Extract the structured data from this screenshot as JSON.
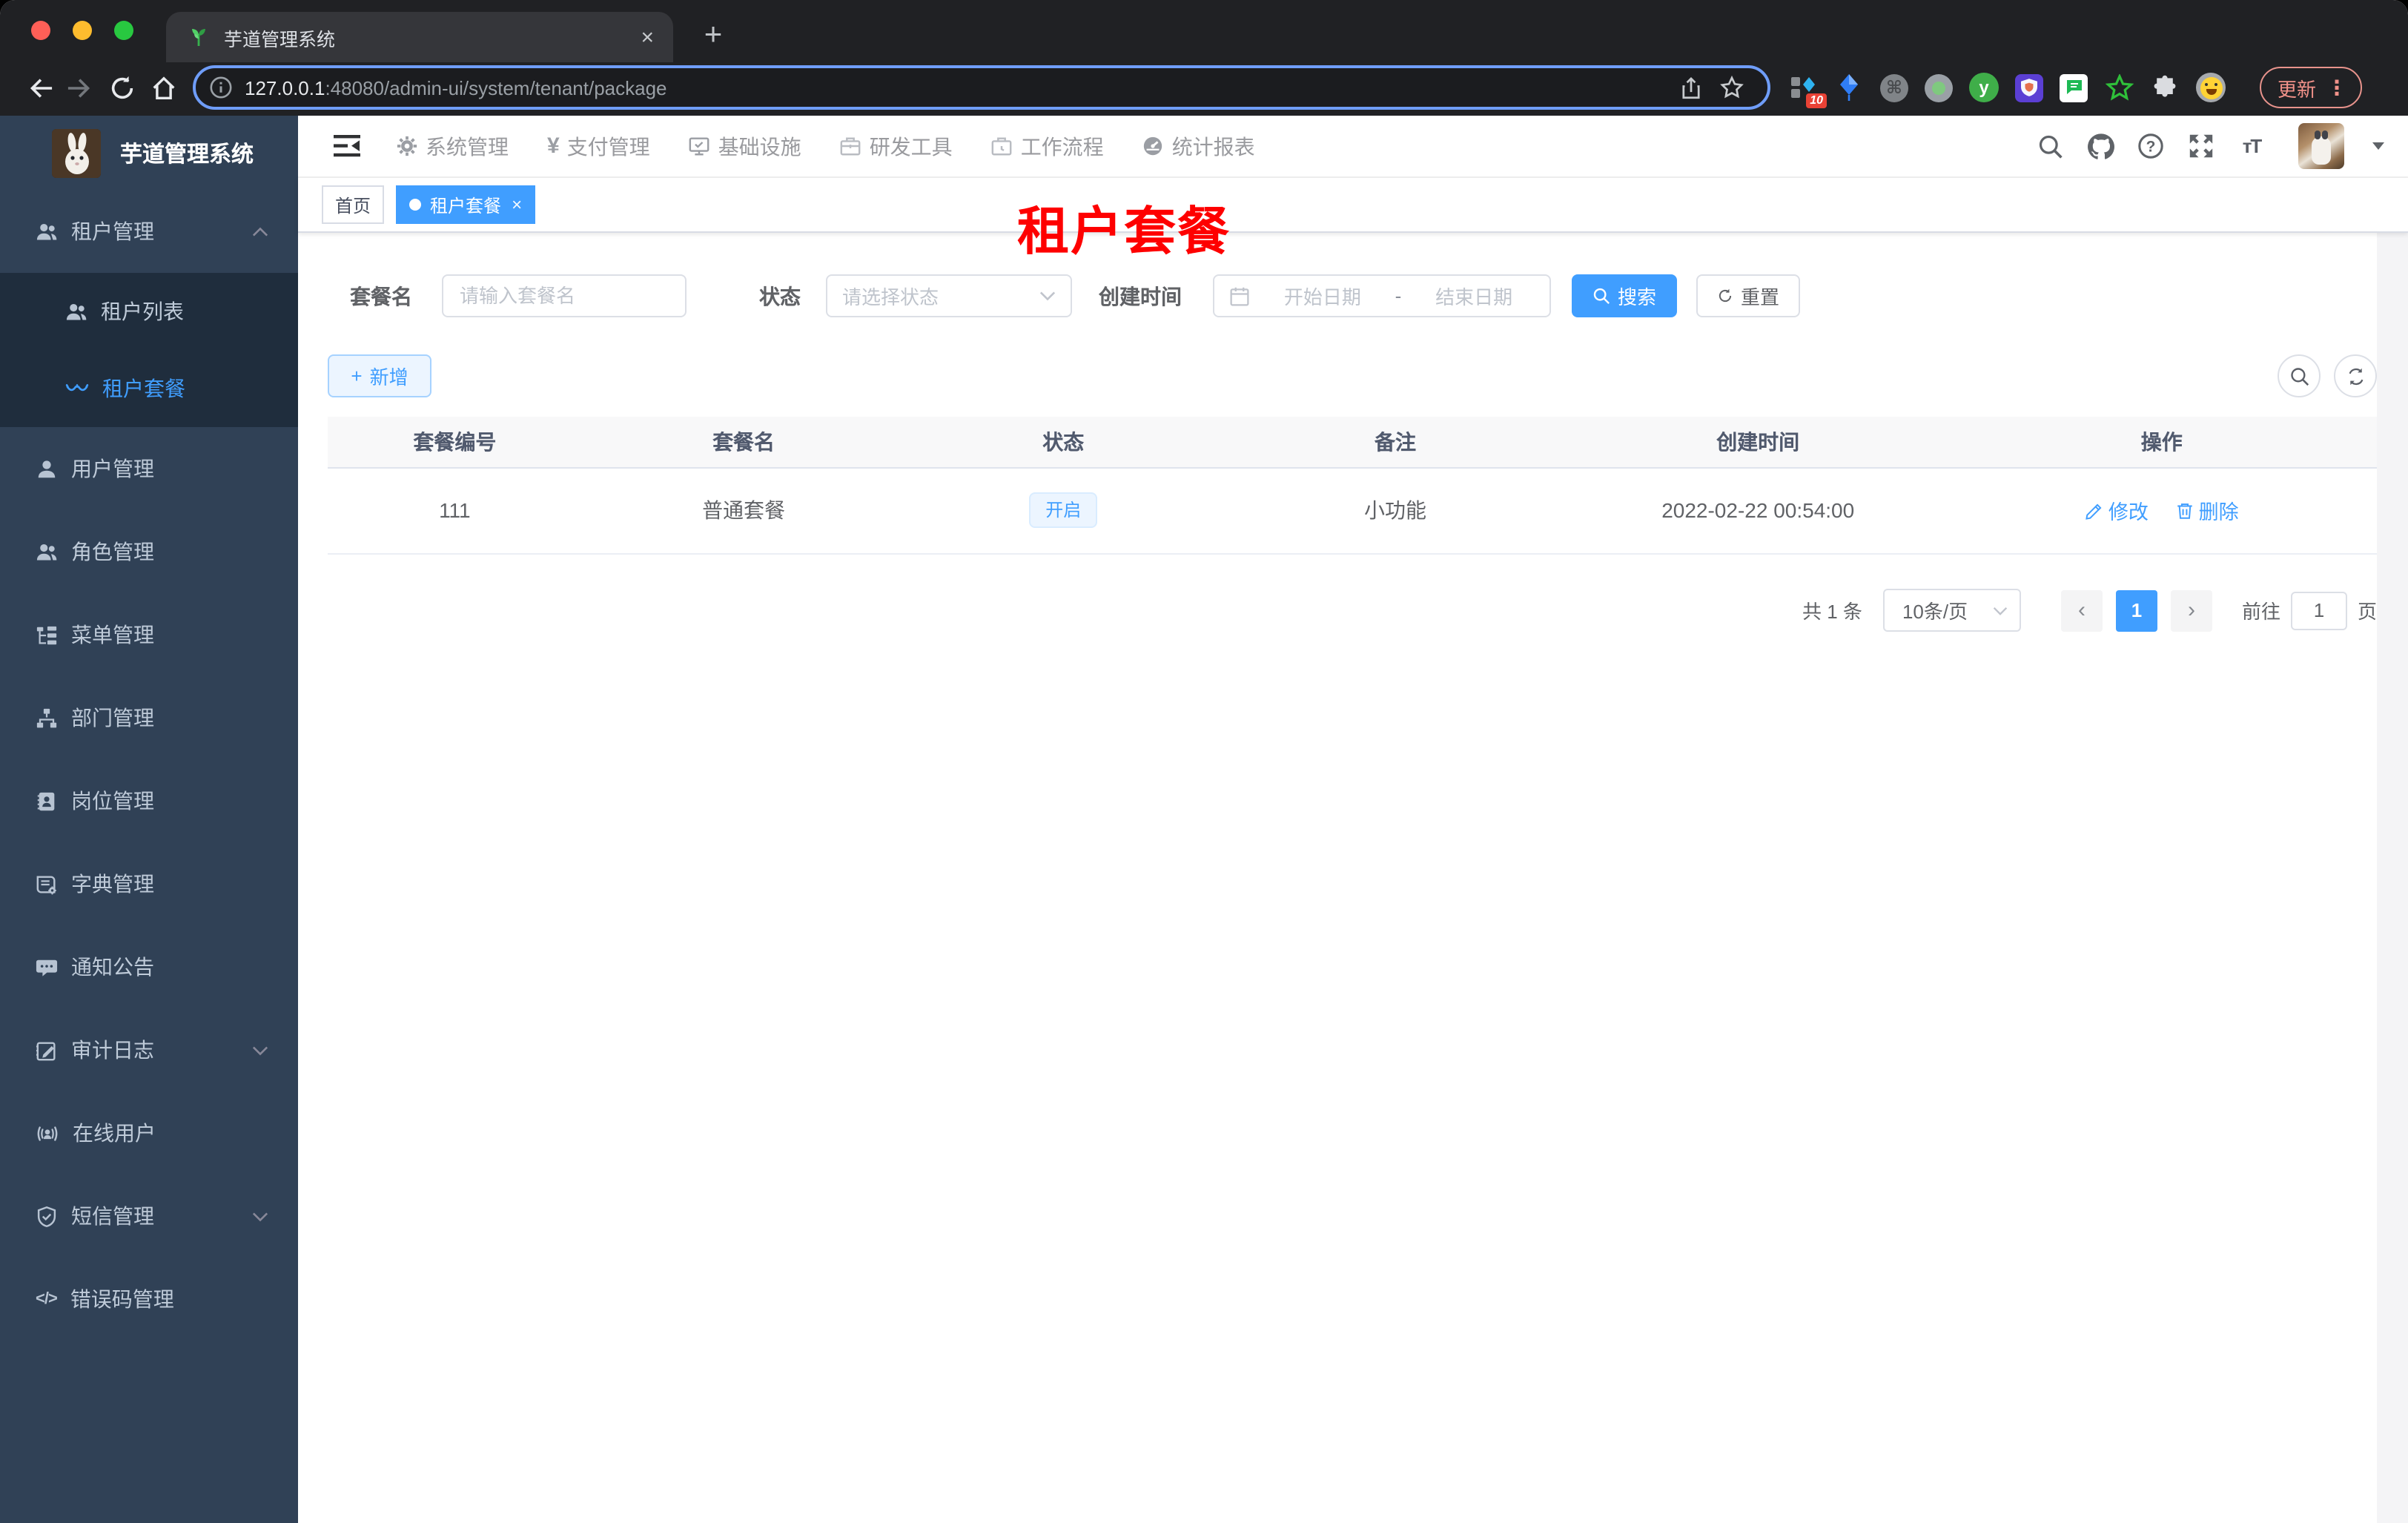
{
  "browser": {
    "tab_title": "芋道管理系统",
    "close_glyph": "×",
    "new_tab_glyph": "+",
    "url_host": "127.0.0.1",
    "url_path": ":48080/admin-ui/system/tenant/package",
    "extension_badge": "10",
    "command_glyph": "⌘",
    "ext_letter": "y",
    "update_label": "更新",
    "menu_glyph": "⋮"
  },
  "app": {
    "logo_title": "芋道管理系统",
    "topnav": {
      "items": [
        {
          "label": "系统管理"
        },
        {
          "label": "支付管理",
          "glyph": "¥"
        },
        {
          "label": "基础设施"
        },
        {
          "label": "研发工具"
        },
        {
          "label": "工作流程"
        },
        {
          "label": "统计报表"
        }
      ]
    },
    "header_tools": {
      "fontsize_glyph": "тT"
    },
    "sidebar": [
      {
        "label": "租户管理"
      },
      {
        "label": "租户列表"
      },
      {
        "label": "租户套餐"
      },
      {
        "label": "用户管理"
      },
      {
        "label": "角色管理"
      },
      {
        "label": "菜单管理"
      },
      {
        "label": "部门管理"
      },
      {
        "label": "岗位管理"
      },
      {
        "label": "字典管理"
      },
      {
        "label": "通知公告"
      },
      {
        "label": "审计日志"
      },
      {
        "label": "在线用户"
      },
      {
        "label": "短信管理"
      },
      {
        "label": "错误码管理",
        "glyph": "</>"
      }
    ],
    "tags": {
      "home": "首页",
      "active": "租户套餐",
      "close_glyph": "×"
    },
    "page_watermark": "租户套餐",
    "filters": {
      "name_label": "套餐名",
      "name_placeholder": "请输入套餐名",
      "status_label": "状态",
      "status_placeholder": "请选择状态",
      "date_label": "创建时间",
      "date_start_placeholder": "开始日期",
      "date_separator": "-",
      "date_end_placeholder": "结束日期",
      "search_label": "搜索",
      "reset_label": "重置"
    },
    "toolbar": {
      "add_label": "新增",
      "add_glyph": "+"
    },
    "table": {
      "headers": [
        "套餐编号",
        "套餐名",
        "状态",
        "备注",
        "创建时间",
        "操作"
      ],
      "rows": [
        {
          "id": "111",
          "name": "普通套餐",
          "status": "开启",
          "remark": "小功能",
          "created_at": "2022-02-22 00:54:00",
          "edit_label": "修改",
          "delete_label": "删除"
        }
      ]
    },
    "pagination": {
      "total": "共 1 条",
      "page_size": "10条/页",
      "prev_glyph": "‹",
      "current_page": "1",
      "next_glyph": "›",
      "goto_label": "前往",
      "goto_value": "1",
      "unit_label": "页"
    },
    "colors": {
      "accent": "#409eff",
      "watermark_red": "#fe0000",
      "sidebar_bg": "#304156",
      "submenu_bg": "#1f2d3d"
    }
  }
}
